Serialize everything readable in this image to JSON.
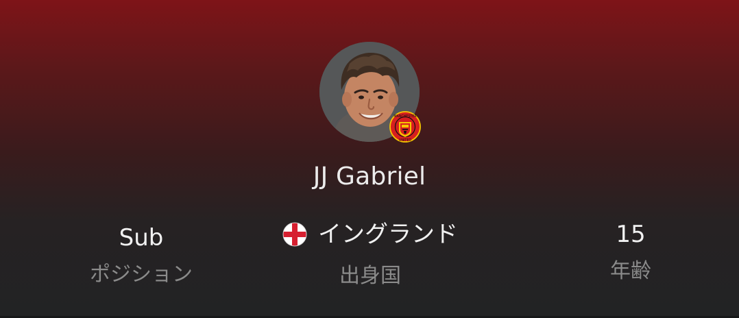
{
  "player": {
    "name": "JJ Gabriel"
  },
  "stats": {
    "position": {
      "value": "Sub",
      "label": "ポジション"
    },
    "nationality": {
      "value": "イングランド",
      "label": "出身国",
      "flag_icon": "england-flag-icon"
    },
    "age": {
      "value": "15",
      "label": "年齢"
    }
  },
  "club": {
    "badge_icon": "manchester-united-crest-icon",
    "badge_text_top": "MANCHESTER",
    "badge_text_bottom": "UNITED"
  },
  "colors": {
    "gradient_top": "#7e1418",
    "gradient_bottom": "#222324",
    "name_text": "#ececec",
    "label_text": "#8b8b8b",
    "club_red": "#d71f1f",
    "club_yellow": "#f7c500"
  }
}
